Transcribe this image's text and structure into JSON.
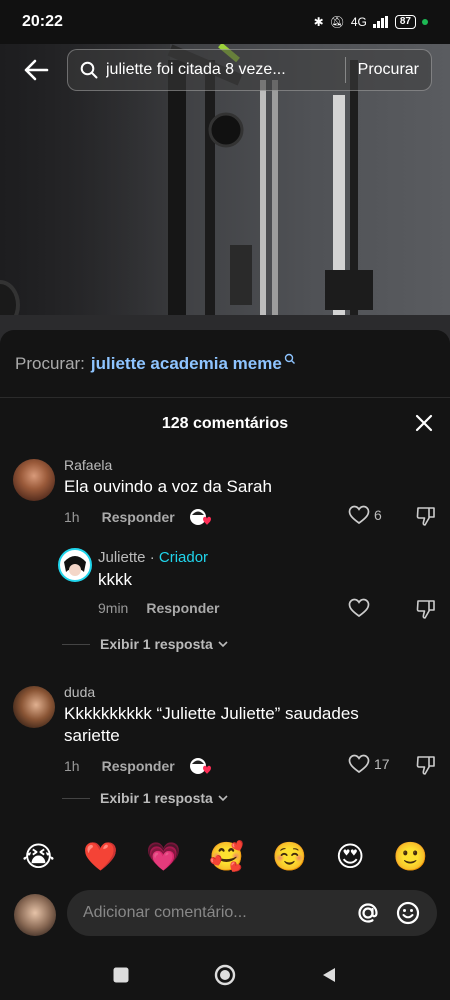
{
  "status_bar": {
    "time": "20:22",
    "network": "4G",
    "battery": "87"
  },
  "search": {
    "query": "juliette foi citada 8 veze...",
    "submit_label": "Procurar"
  },
  "related_search": {
    "label": "Procurar:",
    "query": "juliette academia meme"
  },
  "comments": {
    "count_label": "128 comentários",
    "items": [
      {
        "username": "Rafaela",
        "text": "Ela ouvindo a voz da Sarah",
        "time": "1h",
        "reply_label": "Responder",
        "likes": "6"
      },
      {
        "username": "Juliette",
        "separator": "·",
        "badge": "Criador",
        "text": "kkkk",
        "time": "9min",
        "reply_label": "Responder",
        "likes": "",
        "view_replies": "Exibir 1 resposta"
      },
      {
        "username": "duda",
        "text": "Kkkkkkkkkk “Juliette Juliette” saudades sariette",
        "time": "1h",
        "reply_label": "Responder",
        "likes": "17",
        "view_replies": "Exibir 1 resposta"
      }
    ]
  },
  "emojis": [
    "😭",
    "❤️",
    "💗",
    "🥰",
    "☺️",
    "😍",
    "🙂"
  ],
  "comment_input": {
    "placeholder": "Adicionar comentário..."
  },
  "colors": {
    "accent_creator": "#20d5ec",
    "related_query": "#8ec4ff",
    "sheet_bg": "#141414"
  }
}
